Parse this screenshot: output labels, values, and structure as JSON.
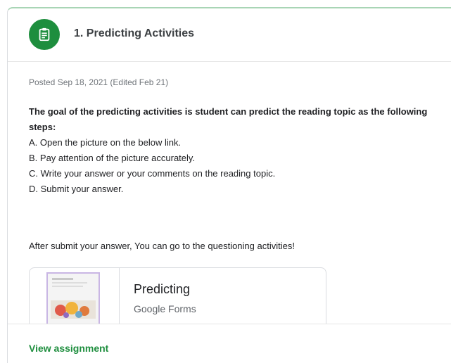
{
  "assignment": {
    "icon": "assignment-icon",
    "title": "1. Predicting Activities",
    "posted": "Posted Sep 18, 2021 (Edited Feb 21)",
    "instructions": {
      "intro": "The goal of the predicting activities is student can predict the reading topic as the following steps:",
      "steps": [
        "A. Open the picture on the below link.",
        "B. Pay attention of the picture accurately.",
        "C. Write your answer or your comments on the reading topic.",
        "D. Submit your answer."
      ]
    },
    "after_note": "After submit your answer, You can go to the questioning activities!",
    "attachment": {
      "title": "Predicting",
      "type": "Google Forms"
    },
    "view_link": "View assignment"
  },
  "colors": {
    "accent_green": "#1e8e3e",
    "border": "#dadce0",
    "top_border": "#a8d5b5"
  }
}
